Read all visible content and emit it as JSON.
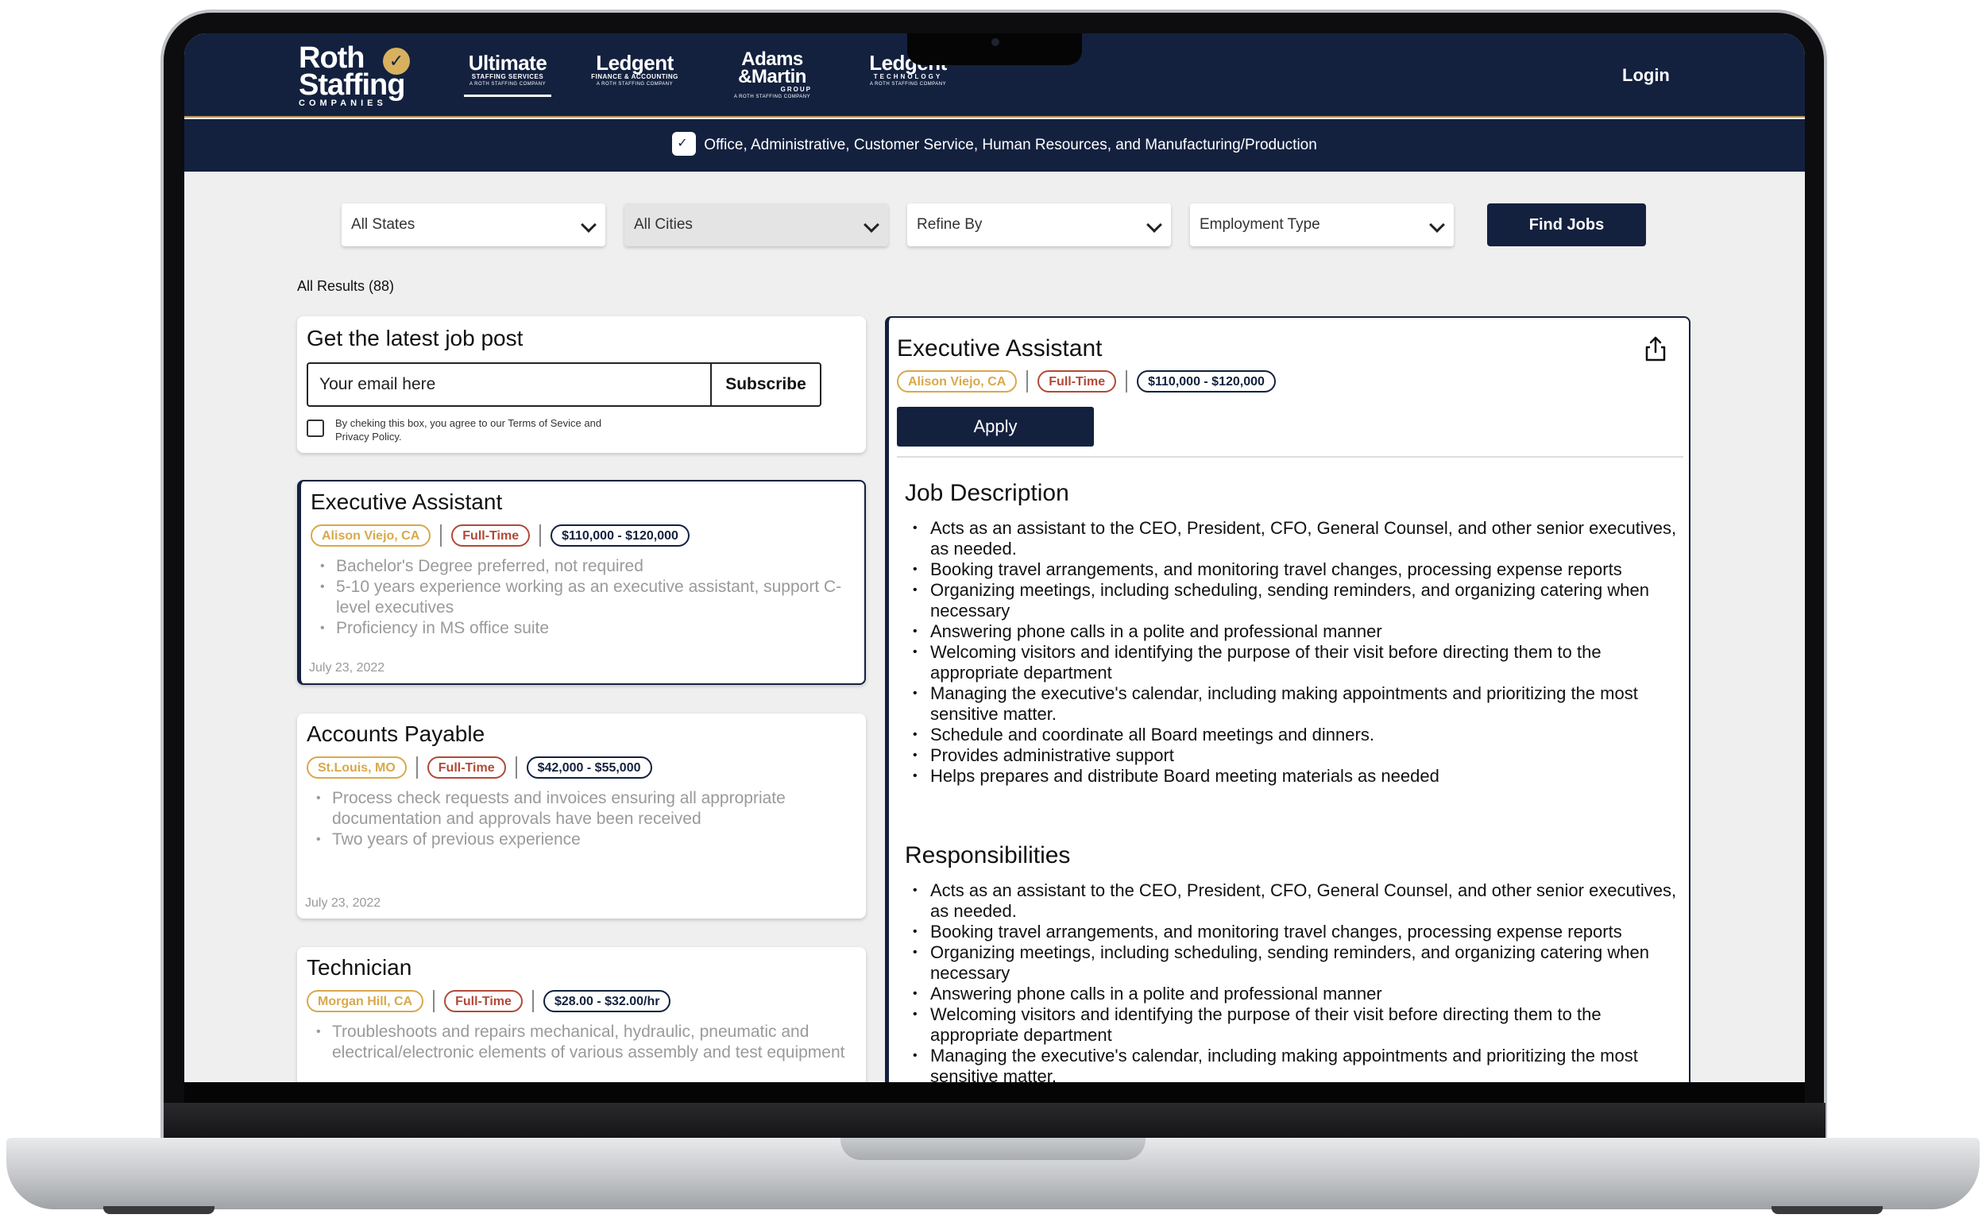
{
  "header": {
    "brands": [
      {
        "main": "Ultimate",
        "sub": "STAFFING SERVICES",
        "sub2": "A ROTH STAFFING COMPANY"
      },
      {
        "main": "Ledgent",
        "sub": "FINANCE & ACCOUNTING",
        "sub2": "A ROTH STAFFING COMPANY"
      },
      {
        "main": "Adams",
        "main2": "&Martin",
        "sub": "GROUP",
        "sub2": "A ROTH STAFFING COMPANY"
      },
      {
        "main": "Ledgent",
        "sub": "TECHNOLOGY",
        "sub2": "A ROTH STAFFING COMPANY"
      }
    ],
    "logo": {
      "line1": "Roth",
      "line2": "Staffing",
      "line3": "COMPANIES"
    },
    "login_label": "Login",
    "tagline": "Office, Administrative, Customer Service, Human Resources, and Manufacturing/Production"
  },
  "filters": {
    "states": "All States",
    "cities": "All Cities",
    "refine": "Refine By",
    "employment": "Employment Type",
    "find_label": "Find Jobs"
  },
  "results": {
    "label": "All Results (88)"
  },
  "subscribe": {
    "title": "Get the latest job post",
    "placeholder": "Your email here",
    "button": "Subscribe",
    "terms": "By cheking this box, you agree to our Terms of Sevice and Privacy Policy."
  },
  "jobs": [
    {
      "title": "Executive Assistant",
      "location": "Alison Viejo, CA",
      "type": "Full-Time",
      "pay": "$110,000 - $120,000",
      "bullets": [
        "Bachelor's Degree preferred, not required",
        "5-10 years experience working as an executive assistant, support C- level executives",
        "Proficiency in MS office suite"
      ],
      "date": "July 23, 2022"
    },
    {
      "title": "Accounts Payable",
      "location": "St.Louis, MO",
      "type": "Full-Time",
      "pay": "$42,000 - $55,000",
      "bullets": [
        "Process check requests and invoices ensuring all appropriate documentation and approvals have been received",
        "Two years of previous experience"
      ],
      "date": "July 23, 2022"
    },
    {
      "title": "Technician",
      "location": "Morgan Hill, CA",
      "type": "Full-Time",
      "pay": "$28.00 - $32.00/hr",
      "bullets": [
        "Troubleshoots and repairs mechanical, hydraulic, pneumatic and electrical/electronic elements of various assembly and test equipment"
      ],
      "date": ""
    }
  ],
  "detail": {
    "title": "Executive Assistant",
    "location": "Alison Viejo, CA",
    "type": "Full-Time",
    "pay": "$110,000 - $120,000",
    "apply_label": "Apply",
    "description_heading": "Job Description",
    "description": [
      "Acts as an assistant to the CEO, President, CFO, General Counsel, and other senior executives, as needed.",
      "Booking travel arrangements, and monitoring travel changes, processing expense reports",
      "Organizing meetings, including scheduling, sending reminders, and organizing catering when necessary",
      "Answering phone calls in a polite and professional manner",
      "Welcoming visitors and identifying the purpose of their visit before directing them to the appropriate department",
      "Managing the executive's calendar, including making appointments and prioritizing the most sensitive matter.",
      "Schedule and coordinate all Board meetings and dinners.",
      "Provides administrative support",
      "Helps prepares and distribute Board meeting materials as needed"
    ],
    "responsibilities_heading": "Responsibilities",
    "responsibilities": [
      "Acts as an assistant to the CEO, President, CFO, General Counsel, and other senior executives, as needed.",
      "Booking travel arrangements, and monitoring travel changes, processing expense reports",
      "Organizing meetings, including scheduling, sending reminders, and organizing catering when necessary",
      "Answering phone calls in a polite and professional manner",
      "Welcoming visitors and identifying the purpose of their visit before directing them to the appropriate department",
      "Managing the executive's calendar, including making appointments and prioritizing the most sensitive matter."
    ]
  },
  "colors": {
    "navy": "#13213f",
    "gold": "#d7a94b",
    "rust": "#b04a38",
    "accent": "#b9945a"
  }
}
